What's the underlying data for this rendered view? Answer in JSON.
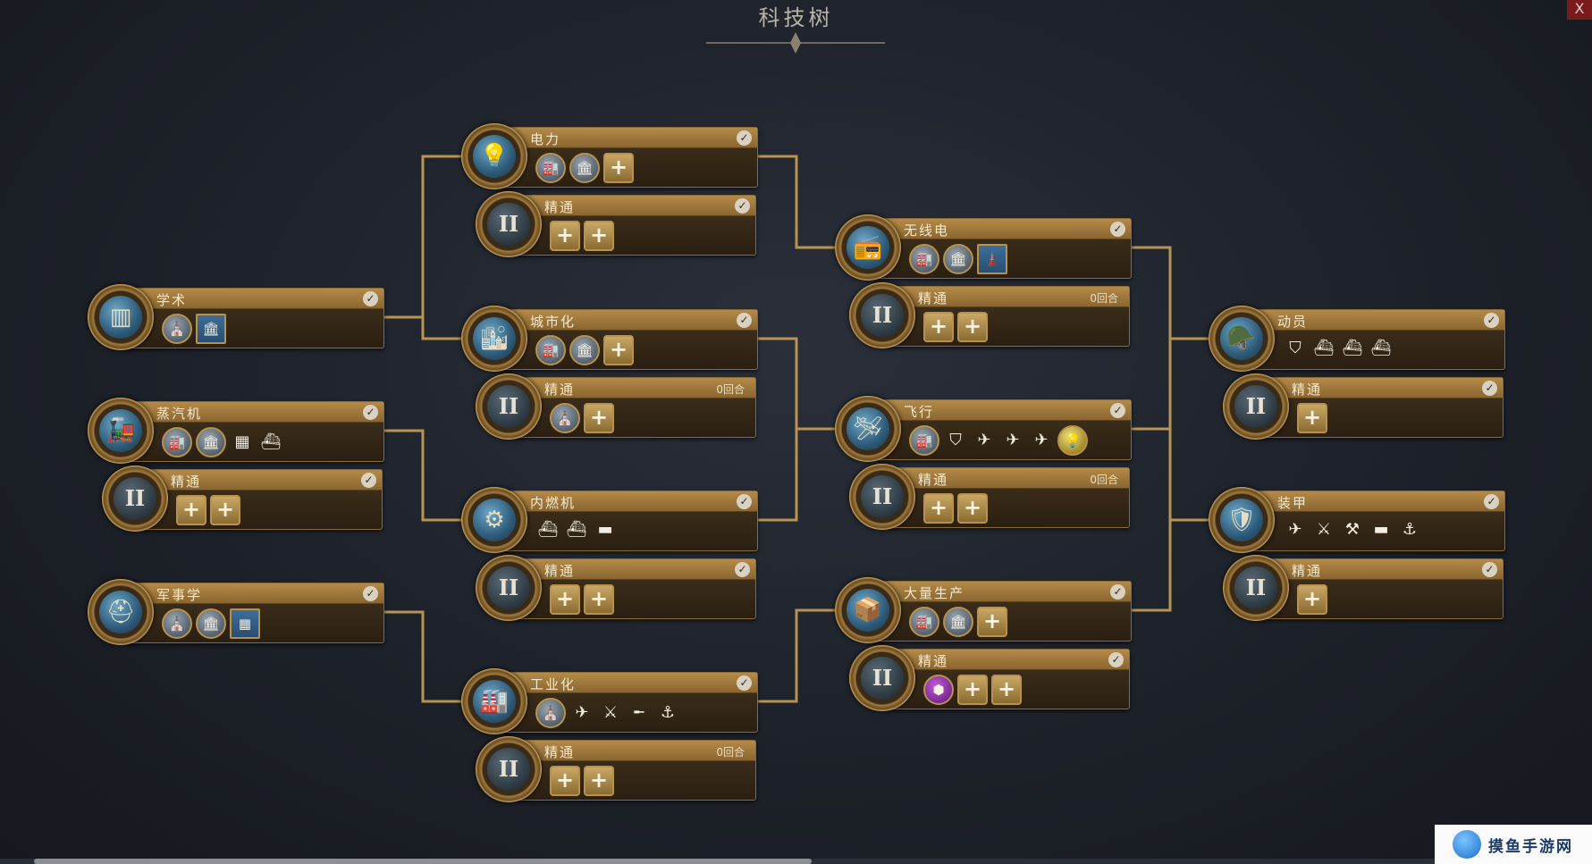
{
  "screen": {
    "title": "科技树",
    "close_label": "X"
  },
  "mastery_label": "精通",
  "mastery_symbol": "II",
  "techs": [
    {
      "id": "scholarship",
      "name": "学术",
      "icon": "column-icon",
      "glyph": "▥",
      "completed": true,
      "items": [
        {
          "t": "c",
          "g": "⛪"
        },
        {
          "t": "sq",
          "g": "🏛"
        }
      ],
      "mastery": null
    },
    {
      "id": "steam",
      "name": "蒸汽机",
      "icon": "locomotive-icon",
      "glyph": "🚂",
      "completed": true,
      "items": [
        {
          "t": "c",
          "g": "🏭"
        },
        {
          "t": "c",
          "g": "🏛"
        },
        {
          "t": "s",
          "g": "▦"
        },
        {
          "t": "s",
          "g": "⛴"
        }
      ],
      "mastery": {
        "completed": true,
        "turns": "",
        "items": [
          {
            "t": "p"
          },
          {
            "t": "p"
          }
        ]
      }
    },
    {
      "id": "military_science",
      "name": "军事学",
      "icon": "helmet-icon",
      "glyph": "⛑",
      "completed": true,
      "items": [
        {
          "t": "c",
          "g": "⛪"
        },
        {
          "t": "c",
          "g": "🏛"
        },
        {
          "t": "sq",
          "g": "▦"
        }
      ],
      "mastery": null
    },
    {
      "id": "electricity",
      "name": "电力",
      "icon": "lightbulb-icon",
      "glyph": "💡",
      "completed": true,
      "items": [
        {
          "t": "c",
          "g": "🏭"
        },
        {
          "t": "c",
          "g": "🏛"
        },
        {
          "t": "p"
        }
      ],
      "mastery": {
        "completed": true,
        "turns": "",
        "items": [
          {
            "t": "p"
          },
          {
            "t": "p"
          }
        ]
      }
    },
    {
      "id": "urbanization",
      "name": "城市化",
      "icon": "city-icon",
      "glyph": "🏙",
      "completed": true,
      "items": [
        {
          "t": "c",
          "g": "🏭"
        },
        {
          "t": "c",
          "g": "🏛"
        },
        {
          "t": "p"
        }
      ],
      "mastery": {
        "completed": false,
        "turns": "0回合",
        "items": [
          {
            "t": "c",
            "g": "⛪"
          },
          {
            "t": "p"
          }
        ]
      }
    },
    {
      "id": "combustion",
      "name": "内燃机",
      "icon": "engine-icon",
      "glyph": "⚙",
      "completed": true,
      "items": [
        {
          "t": "s",
          "g": "⛴"
        },
        {
          "t": "s",
          "g": "⛴"
        },
        {
          "t": "s",
          "g": "▬"
        }
      ],
      "mastery": {
        "completed": true,
        "turns": "",
        "items": [
          {
            "t": "p"
          },
          {
            "t": "p"
          }
        ]
      }
    },
    {
      "id": "industrialization",
      "name": "工业化",
      "icon": "factory-icon",
      "glyph": "🏭",
      "completed": true,
      "items": [
        {
          "t": "c",
          "g": "⛪"
        },
        {
          "t": "s",
          "g": "✈"
        },
        {
          "t": "s",
          "g": "⚔"
        },
        {
          "t": "s",
          "g": "╾"
        },
        {
          "t": "s",
          "g": "⚓"
        }
      ],
      "mastery": {
        "completed": false,
        "turns": "0回合",
        "items": [
          {
            "t": "p"
          },
          {
            "t": "p"
          }
        ]
      }
    },
    {
      "id": "radio",
      "name": "无线电",
      "icon": "radio-icon",
      "glyph": "📻",
      "completed": true,
      "items": [
        {
          "t": "c",
          "g": "🏭"
        },
        {
          "t": "c",
          "g": "🏛"
        },
        {
          "t": "sq",
          "g": "🗼"
        }
      ],
      "mastery": {
        "completed": false,
        "turns": "0回合",
        "items": [
          {
            "t": "p"
          },
          {
            "t": "p"
          }
        ]
      }
    },
    {
      "id": "flight",
      "name": "飞行",
      "icon": "biplane-icon",
      "glyph": "🛩",
      "completed": true,
      "items": [
        {
          "t": "c",
          "g": "🏭"
        },
        {
          "t": "s",
          "g": "⛉"
        },
        {
          "t": "s",
          "g": "✈"
        },
        {
          "t": "s",
          "g": "✈"
        },
        {
          "t": "s",
          "g": "✈"
        },
        {
          "t": "b",
          "g": "💡"
        }
      ],
      "mastery": {
        "completed": false,
        "turns": "0回合",
        "items": [
          {
            "t": "p"
          },
          {
            "t": "p"
          }
        ]
      }
    },
    {
      "id": "mass_production",
      "name": "大量生产",
      "icon": "crate-icon",
      "glyph": "📦",
      "completed": true,
      "items": [
        {
          "t": "c",
          "g": "🏭"
        },
        {
          "t": "c",
          "g": "🏛"
        },
        {
          "t": "p"
        }
      ],
      "mastery": {
        "completed": true,
        "turns": "",
        "items": [
          {
            "t": "pu",
            "g": "⬢"
          },
          {
            "t": "p"
          },
          {
            "t": "p"
          }
        ]
      }
    },
    {
      "id": "mobilization",
      "name": "动员",
      "icon": "soldier-icon",
      "glyph": "🪖",
      "completed": true,
      "items": [
        {
          "t": "s",
          "g": "⛉"
        },
        {
          "t": "s",
          "g": "⛴"
        },
        {
          "t": "s",
          "g": "⛴"
        },
        {
          "t": "s",
          "g": "⛴"
        }
      ],
      "mastery": {
        "completed": true,
        "turns": "",
        "items": [
          {
            "t": "p"
          }
        ]
      }
    },
    {
      "id": "armor",
      "name": "装甲",
      "icon": "tank-icon",
      "glyph": "🛡",
      "completed": true,
      "items": [
        {
          "t": "s",
          "g": "✈"
        },
        {
          "t": "s",
          "g": "⚔"
        },
        {
          "t": "s",
          "g": "⚒"
        },
        {
          "t": "s",
          "g": "▬"
        },
        {
          "t": "s",
          "g": "⚓"
        }
      ],
      "mastery": {
        "completed": true,
        "turns": "",
        "items": [
          {
            "t": "p"
          }
        ]
      }
    }
  ],
  "watermark": {
    "text": "摸鱼手游网"
  },
  "colors": {
    "accent_gold": "#b58a48",
    "line_gold": "#c8a058",
    "close_red": "#7a1a1a"
  }
}
